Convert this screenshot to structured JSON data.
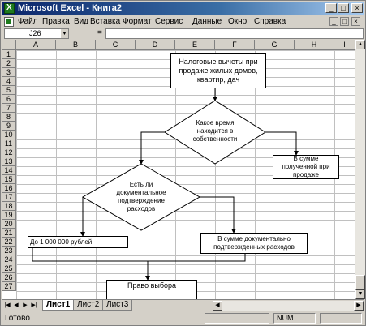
{
  "window": {
    "title": "Microsoft Excel - Книга2",
    "min_glyph": "_",
    "max_glyph": "□",
    "close_glyph": "×"
  },
  "menu": {
    "items": [
      "Файл",
      "Правка",
      "Вид",
      "Вставка",
      "Формат",
      "Сервис",
      "Данные",
      "Окно",
      "Справка"
    ],
    "mdi_min": "_",
    "mdi_max": "□",
    "mdi_close": "×"
  },
  "formula_bar": {
    "name_box": "J26",
    "fx_label": "=",
    "value": ""
  },
  "grid": {
    "columns": [
      "A",
      "B",
      "C",
      "D",
      "E",
      "F",
      "G",
      "H",
      "I"
    ],
    "rows": [
      "1",
      "2",
      "3",
      "4",
      "5",
      "6",
      "7",
      "8",
      "9",
      "10",
      "11",
      "12",
      "13",
      "14",
      "15",
      "16",
      "17",
      "18",
      "19",
      "20",
      "21",
      "22",
      "23",
      "24",
      "25",
      "26",
      "27"
    ]
  },
  "flowchart": {
    "start_box": "Налоговые вычеты при продаже жилых домов, квартир, дач",
    "diamond1": "Какое время находится в собственности",
    "right_box1": "В сумме полученной при продаже",
    "diamond2": "Есть ли документальное подтверждение расходов",
    "left_box": "До 1 000 000 рублей",
    "right_box2": "В сумме документально подтвержденных расходов",
    "final_box": "Право выбора"
  },
  "sheets": {
    "tabs": [
      "Лист1",
      "Лист2",
      "Лист3"
    ],
    "active": "Лист1"
  },
  "status": {
    "ready": "Готово",
    "num": "NUM"
  }
}
